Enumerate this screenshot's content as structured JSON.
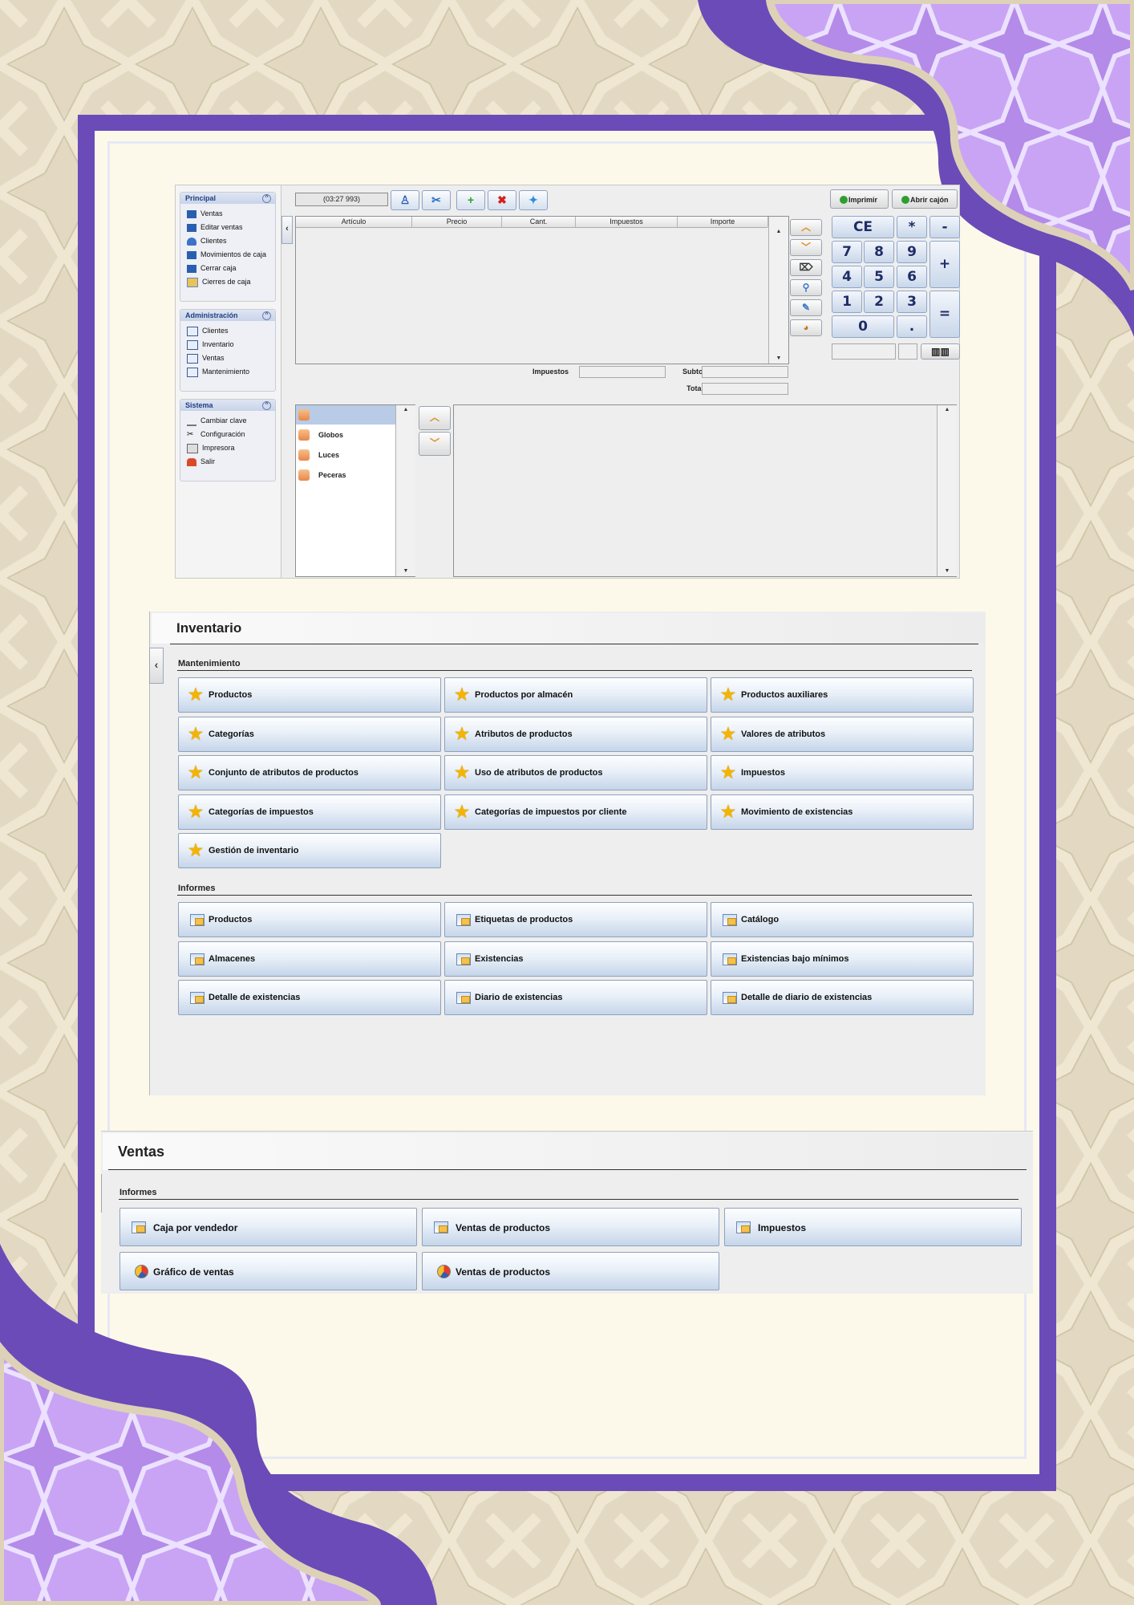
{
  "pos": {
    "sidebar": {
      "principal": {
        "title": "Principal",
        "items": [
          "Ventas",
          "Editar ventas",
          "Clientes",
          "Movimientos de caja",
          "Cerrar caja",
          "Cierres de caja"
        ]
      },
      "administracion": {
        "title": "Administración",
        "items": [
          "Clientes",
          "Inventario",
          "Ventas",
          "Mantenimiento"
        ]
      },
      "sistema": {
        "title": "Sistema",
        "items": [
          "Cambiar clave",
          "Configuración",
          "Impresora",
          "Salir"
        ]
      }
    },
    "status": "(03:27 993)",
    "toolbar_icons": [
      "customer-icon",
      "split-icon",
      "add-icon",
      "delete-icon",
      "magic-icon"
    ],
    "right_buttons": {
      "print": "Imprimir",
      "open_drawer": "Abrir cajón"
    },
    "ticket_columns": [
      "Artículo",
      "Precio",
      "Cant.",
      "Impuestos",
      "Importe"
    ],
    "totals": {
      "taxes_label": "Impuestos",
      "subtotal_label": "Subtotal",
      "total_label": "Total"
    },
    "keypad": {
      "ce": "CE",
      "multiply": "*",
      "minus": "-",
      "plus": "+",
      "equals": "=",
      "seven": "7",
      "eight": "8",
      "nine": "9",
      "four": "4",
      "five": "5",
      "six": "6",
      "one": "1",
      "two": "2",
      "three": "3",
      "zero": "0",
      "dot": "."
    },
    "categories": [
      "",
      "Globos",
      "Luces",
      "Peceras"
    ]
  },
  "inventario": {
    "title": "Inventario",
    "mantenimiento_label": "Mantenimiento",
    "mantenimiento": [
      "Productos",
      "Productos por almacén",
      "Productos auxiliares",
      "Categorías",
      "Atributos de productos",
      "Valores de atributos",
      "Conjunto de atributos de productos",
      "Uso de atributos de productos",
      "Impuestos",
      "Categorías de impuestos",
      "Categorías de impuestos por cliente",
      "Movimiento de existencias",
      "Gestión de inventario"
    ],
    "informes_label": "Informes",
    "informes": [
      "Productos",
      "Etiquetas de productos",
      "Catálogo",
      "Almacenes",
      "Existencias",
      "Existencias bajo mínimos",
      "Detalle de existencias",
      "Diario de existencias",
      "Detalle de diario de existencias"
    ]
  },
  "ventas": {
    "title": "Ventas",
    "informes_label": "Informes",
    "informes": [
      "Caja por vendedor",
      "Ventas de productos",
      "Impuestos"
    ],
    "graficos": [
      "Gráfico de ventas",
      "Ventas de productos"
    ]
  },
  "colors": {
    "frame": "#6a4bb8",
    "paper": "#fcf9ea",
    "accent": "#f4b400"
  }
}
